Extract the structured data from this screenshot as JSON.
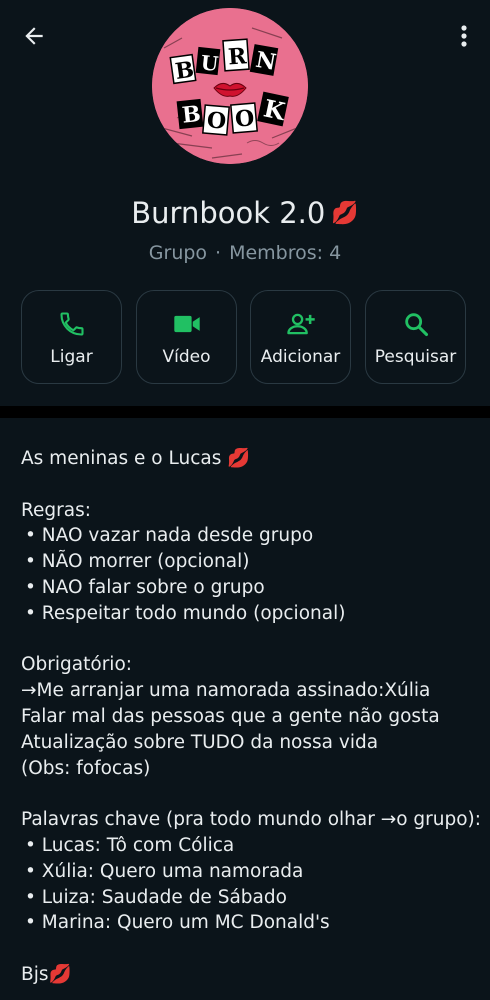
{
  "header": {
    "back_icon": "arrow-left-icon",
    "menu_icon": "more-vertical-icon"
  },
  "avatar": {
    "logo_text": [
      "BURN",
      "BOOK"
    ],
    "bg_color": "#e9708f"
  },
  "group": {
    "name": "Burnbook 2.0",
    "name_emoji": "💋",
    "type": "Grupo",
    "separator": "·",
    "members": "Membros: 4"
  },
  "actions": [
    {
      "label": "Ligar",
      "icon": "phone-icon"
    },
    {
      "label": "Vídeo",
      "icon": "video-icon"
    },
    {
      "label": "Adicionar",
      "icon": "add-person-icon"
    },
    {
      "label": "Pesquisar",
      "icon": "search-icon"
    }
  ],
  "accent_color": "#21c063",
  "description": {
    "intro": "As meninas e o Lucas 💋",
    "rules_title": "Regras:",
    "rules": [
      "• NAO vazar nada desde grupo",
      "• NÃO morrer (opcional)",
      "• NAO falar sobre o grupo",
      "• Respeitar todo mundo (opcional)"
    ],
    "mandatory_title": "Obrigatório:",
    "mandatory": [
      "→Me arranjar uma namorada assinado:Xúlia",
      "Falar mal das pessoas que a gente não gosta",
      "Atualização sobre TUDO da nossa vida",
      "(Obs: fofocas)"
    ],
    "keywords_title": "Palavras chave (pra todo mundo olhar →o grupo):",
    "keywords": [
      "• Lucas: Tô com Cólica",
      "• Xúlia: Quero uma namorada",
      "• Luiza: Saudade de Sábado",
      "• Marina: Quero um MC Donald's"
    ],
    "signoff": "Bjs💋"
  }
}
